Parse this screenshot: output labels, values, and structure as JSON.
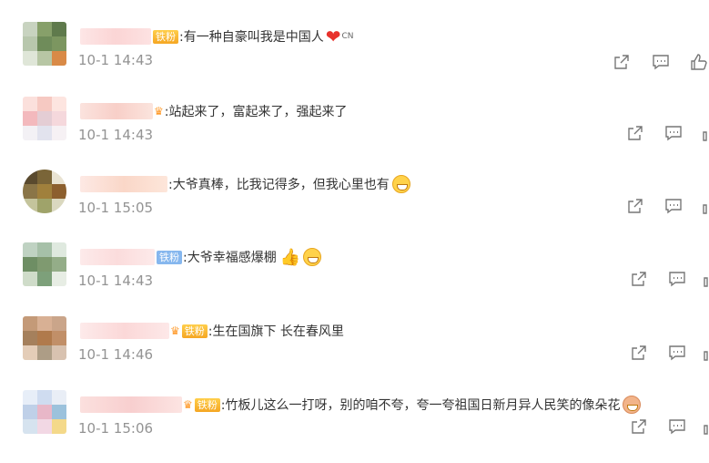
{
  "comments": [
    {
      "text": ":有一种自豪叫我是中国人",
      "time": "10-1 14:43",
      "badge": "铁粉",
      "flag": "CN"
    },
    {
      "text": ":站起来了，富起来了，强起来了",
      "time": "10-1 14:43"
    },
    {
      "text": ":大爷真棒，比我记得多，但我心里也有",
      "time": "10-1 15:05"
    },
    {
      "text": ":大爷幸福感爆棚",
      "time": "10-1 14:43",
      "badge": "铁粉"
    },
    {
      "text": ":生在国旗下 长在春风里",
      "time": "10-1 14:46",
      "badge": "铁粉"
    },
    {
      "text": ":竹板儿这么一打呀，别的咱不夸，夸一夸祖国日新月异人民笑的像朵花",
      "time": "10-1 15:06",
      "badge": "铁粉"
    }
  ],
  "icons": {
    "share": "share-icon",
    "comment": "comment-icon",
    "like": "like-icon",
    "emoji": "grin-emoji-icon",
    "heart": "red-heart-icon",
    "thumb": "thumbs-up-icon"
  }
}
